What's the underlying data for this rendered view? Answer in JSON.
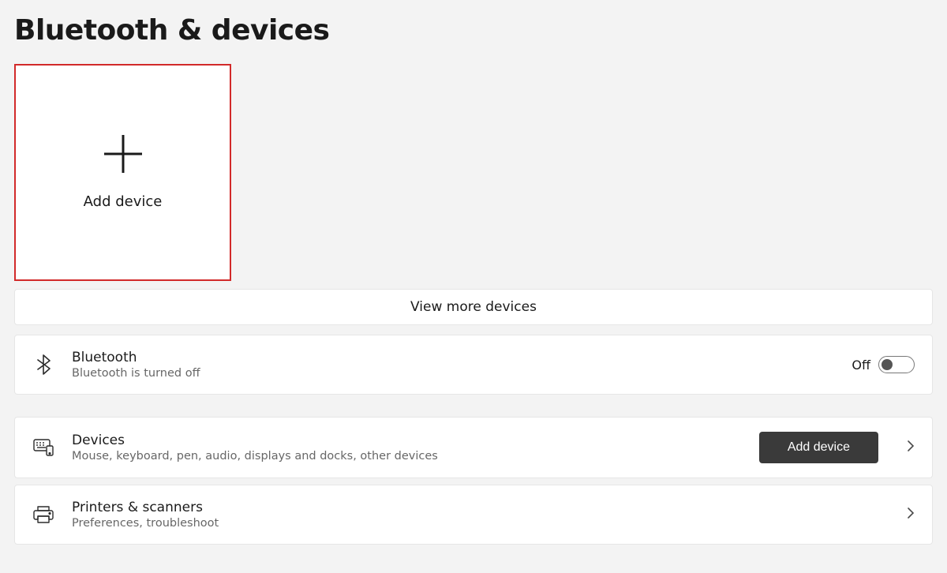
{
  "header": {
    "title": "Bluetooth & devices"
  },
  "addTile": {
    "label": "Add device"
  },
  "viewMore": {
    "label": "View more devices"
  },
  "bluetooth": {
    "title": "Bluetooth",
    "subtitle": "Bluetooth is turned off",
    "stateLabel": "Off"
  },
  "devices": {
    "title": "Devices",
    "subtitle": "Mouse, keyboard, pen, audio, displays and docks, other devices",
    "buttonLabel": "Add device"
  },
  "printers": {
    "title": "Printers & scanners",
    "subtitle": "Preferences, troubleshoot"
  }
}
